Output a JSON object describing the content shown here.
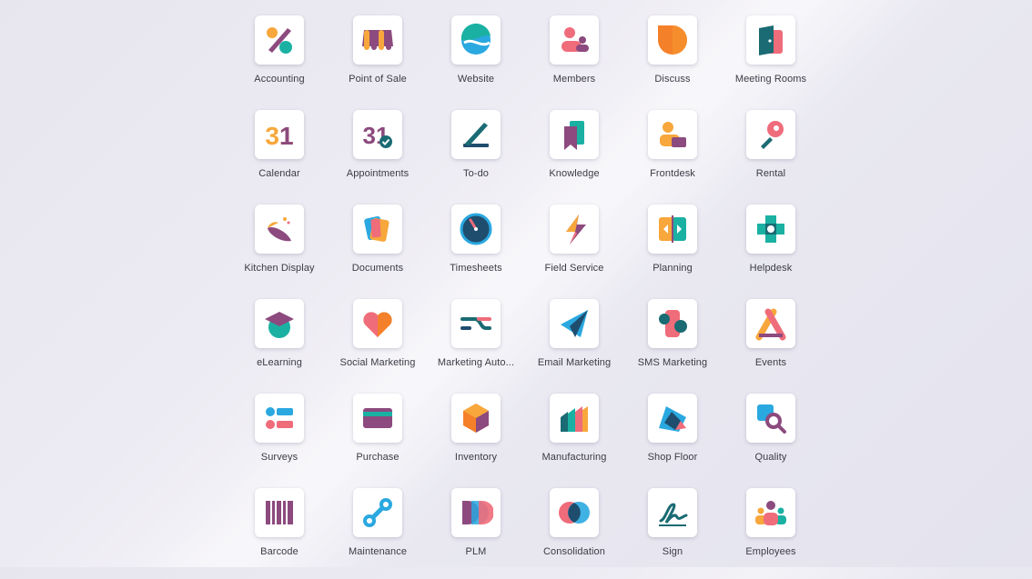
{
  "apps": [
    {
      "name": "Accounting",
      "icon": "accounting-icon"
    },
    {
      "name": "Point of Sale",
      "icon": "point-of-sale-icon"
    },
    {
      "name": "Website",
      "icon": "website-icon"
    },
    {
      "name": "Members",
      "icon": "members-icon"
    },
    {
      "name": "Discuss",
      "icon": "discuss-icon"
    },
    {
      "name": "Meeting Rooms",
      "icon": "meeting-rooms-icon"
    },
    {
      "name": "Calendar",
      "icon": "calendar-icon"
    },
    {
      "name": "Appointments",
      "icon": "appointments-icon"
    },
    {
      "name": "To-do",
      "icon": "todo-icon"
    },
    {
      "name": "Knowledge",
      "icon": "knowledge-icon"
    },
    {
      "name": "Frontdesk",
      "icon": "frontdesk-icon"
    },
    {
      "name": "Rental",
      "icon": "rental-icon"
    },
    {
      "name": "Kitchen Display",
      "icon": "kitchen-display-icon"
    },
    {
      "name": "Documents",
      "icon": "documents-icon"
    },
    {
      "name": "Timesheets",
      "icon": "timesheets-icon"
    },
    {
      "name": "Field Service",
      "icon": "field-service-icon"
    },
    {
      "name": "Planning",
      "icon": "planning-icon"
    },
    {
      "name": "Helpdesk",
      "icon": "helpdesk-icon"
    },
    {
      "name": "eLearning",
      "icon": "elearning-icon"
    },
    {
      "name": "Social Marketing",
      "icon": "social-marketing-icon"
    },
    {
      "name": "Marketing Auto...",
      "icon": "marketing-automation-icon"
    },
    {
      "name": "Email Marketing",
      "icon": "email-marketing-icon"
    },
    {
      "name": "SMS Marketing",
      "icon": "sms-marketing-icon"
    },
    {
      "name": "Events",
      "icon": "events-icon"
    },
    {
      "name": "Surveys",
      "icon": "surveys-icon"
    },
    {
      "name": "Purchase",
      "icon": "purchase-icon"
    },
    {
      "name": "Inventory",
      "icon": "inventory-icon"
    },
    {
      "name": "Manufacturing",
      "icon": "manufacturing-icon"
    },
    {
      "name": "Shop Floor",
      "icon": "shop-floor-icon"
    },
    {
      "name": "Quality",
      "icon": "quality-icon"
    },
    {
      "name": "Barcode",
      "icon": "barcode-icon"
    },
    {
      "name": "Maintenance",
      "icon": "maintenance-icon"
    },
    {
      "name": "PLM",
      "icon": "plm-icon"
    },
    {
      "name": "Consolidation",
      "icon": "consolidation-icon"
    },
    {
      "name": "Sign",
      "icon": "sign-icon"
    },
    {
      "name": "Employees",
      "icon": "employees-icon"
    }
  ],
  "calendar_icon_text": "31",
  "colors": {
    "purple": "#8c4a7e",
    "teal": "#1ab1a3",
    "pink": "#ef6c7a",
    "orange": "#f7a73b",
    "blue": "#2aa8e0",
    "darkteal": "#1a6b73",
    "navy": "#1f4d6e"
  }
}
